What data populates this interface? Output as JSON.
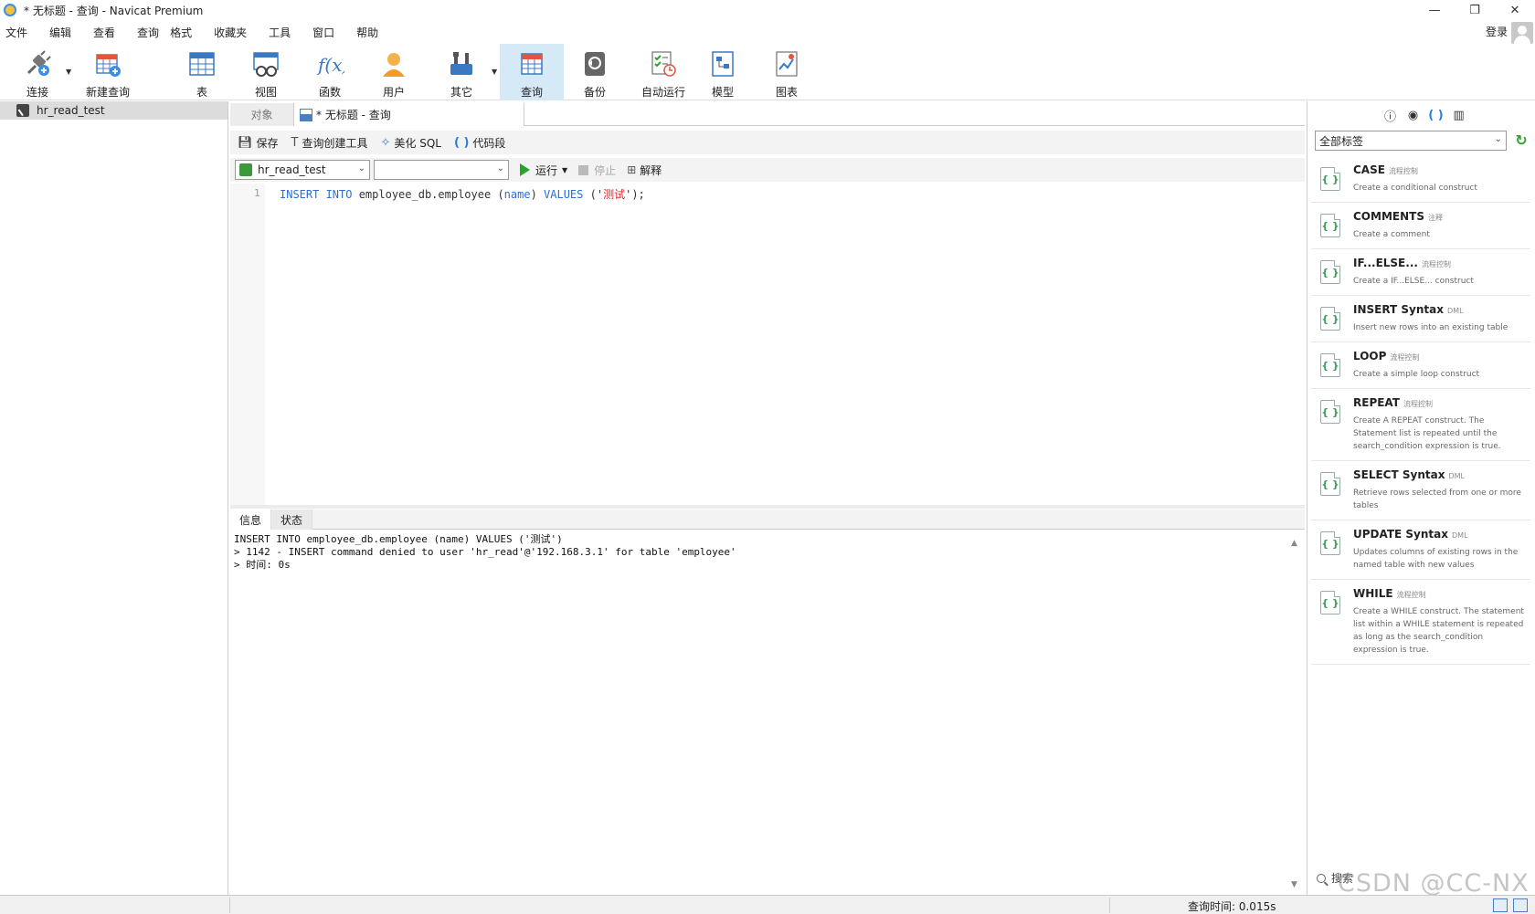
{
  "window": {
    "title": "* 无标题 - 查询 - Navicat Premium",
    "controls": [
      "—",
      "❐",
      "✕"
    ]
  },
  "menu": {
    "items": [
      "文件",
      "编辑",
      "查看",
      "查询",
      "格式",
      "收藏夹",
      "工具",
      "窗口",
      "帮助"
    ],
    "login_label": "登录"
  },
  "toolbar": {
    "connect": "连接",
    "new_query": "新建查询",
    "table": "表",
    "view": "视图",
    "function": "函数",
    "user": "用户",
    "other": "其它",
    "query": "查询",
    "backup": "备份",
    "auto_run": "自动运行",
    "model": "模型",
    "chart": "图表"
  },
  "sidebar": {
    "connection_name": "hr_read_test"
  },
  "tabs": {
    "objects": "对象",
    "query_tab": "* 无标题 - 查询"
  },
  "query_toolbar": {
    "save": "保存",
    "query_builder": "查询创建工具",
    "beautify": "美化 SQL",
    "code_snippet": "代码段"
  },
  "selectors": {
    "connection": "hr_read_test",
    "database": "",
    "run": "运行",
    "stop": "停止",
    "explain": "解释"
  },
  "editor": {
    "line_number": "1",
    "sql_kw_insert": "INSERT INTO",
    "sql_table": " employee_db.employee ",
    "sql_paren_open": "(",
    "sql_col": "name",
    "sql_paren_close": ") ",
    "sql_kw_values": "VALUES",
    "sql_open": " ('",
    "sql_str": "测试",
    "sql_close": "');"
  },
  "result": {
    "tab_info": "信息",
    "tab_status": "状态",
    "line1": "INSERT INTO employee_db.employee (name) VALUES ('测试')",
    "line2": "> 1142 - INSERT command denied to user 'hr_read'@'192.168.3.1' for table 'employee'",
    "line3": "> 时间: 0s"
  },
  "snippets": {
    "filter": "全部标签",
    "items": [
      {
        "name": "CASE",
        "tag": "流程控制",
        "desc": "Create a conditional construct"
      },
      {
        "name": "COMMENTS",
        "tag": "注释",
        "desc": "Create a comment"
      },
      {
        "name": "IF...ELSE...",
        "tag": "流程控制",
        "desc": "Create a IF...ELSE... construct"
      },
      {
        "name": "INSERT Syntax",
        "tag": "DML",
        "desc": "Insert new rows into an existing table"
      },
      {
        "name": "LOOP",
        "tag": "流程控制",
        "desc": "Create a simple loop construct"
      },
      {
        "name": "REPEAT",
        "tag": "流程控制",
        "desc": "Create A REPEAT construct. The Statement list is repeated until the search_condition expression is true."
      },
      {
        "name": "SELECT Syntax",
        "tag": "DML",
        "desc": "Retrieve rows selected from one or more tables"
      },
      {
        "name": "UPDATE Syntax",
        "tag": "DML",
        "desc": "Updates columns of existing rows in the named table with new values"
      },
      {
        "name": "WHILE",
        "tag": "流程控制",
        "desc": "Create a WHILE construct. The statement list within a WHILE statement is repeated as long as the search_condition expression is true."
      }
    ],
    "search_label": "搜索"
  },
  "status": {
    "query_time": "查询时间: 0.015s"
  },
  "watermark": "CSDN @CC-NX"
}
